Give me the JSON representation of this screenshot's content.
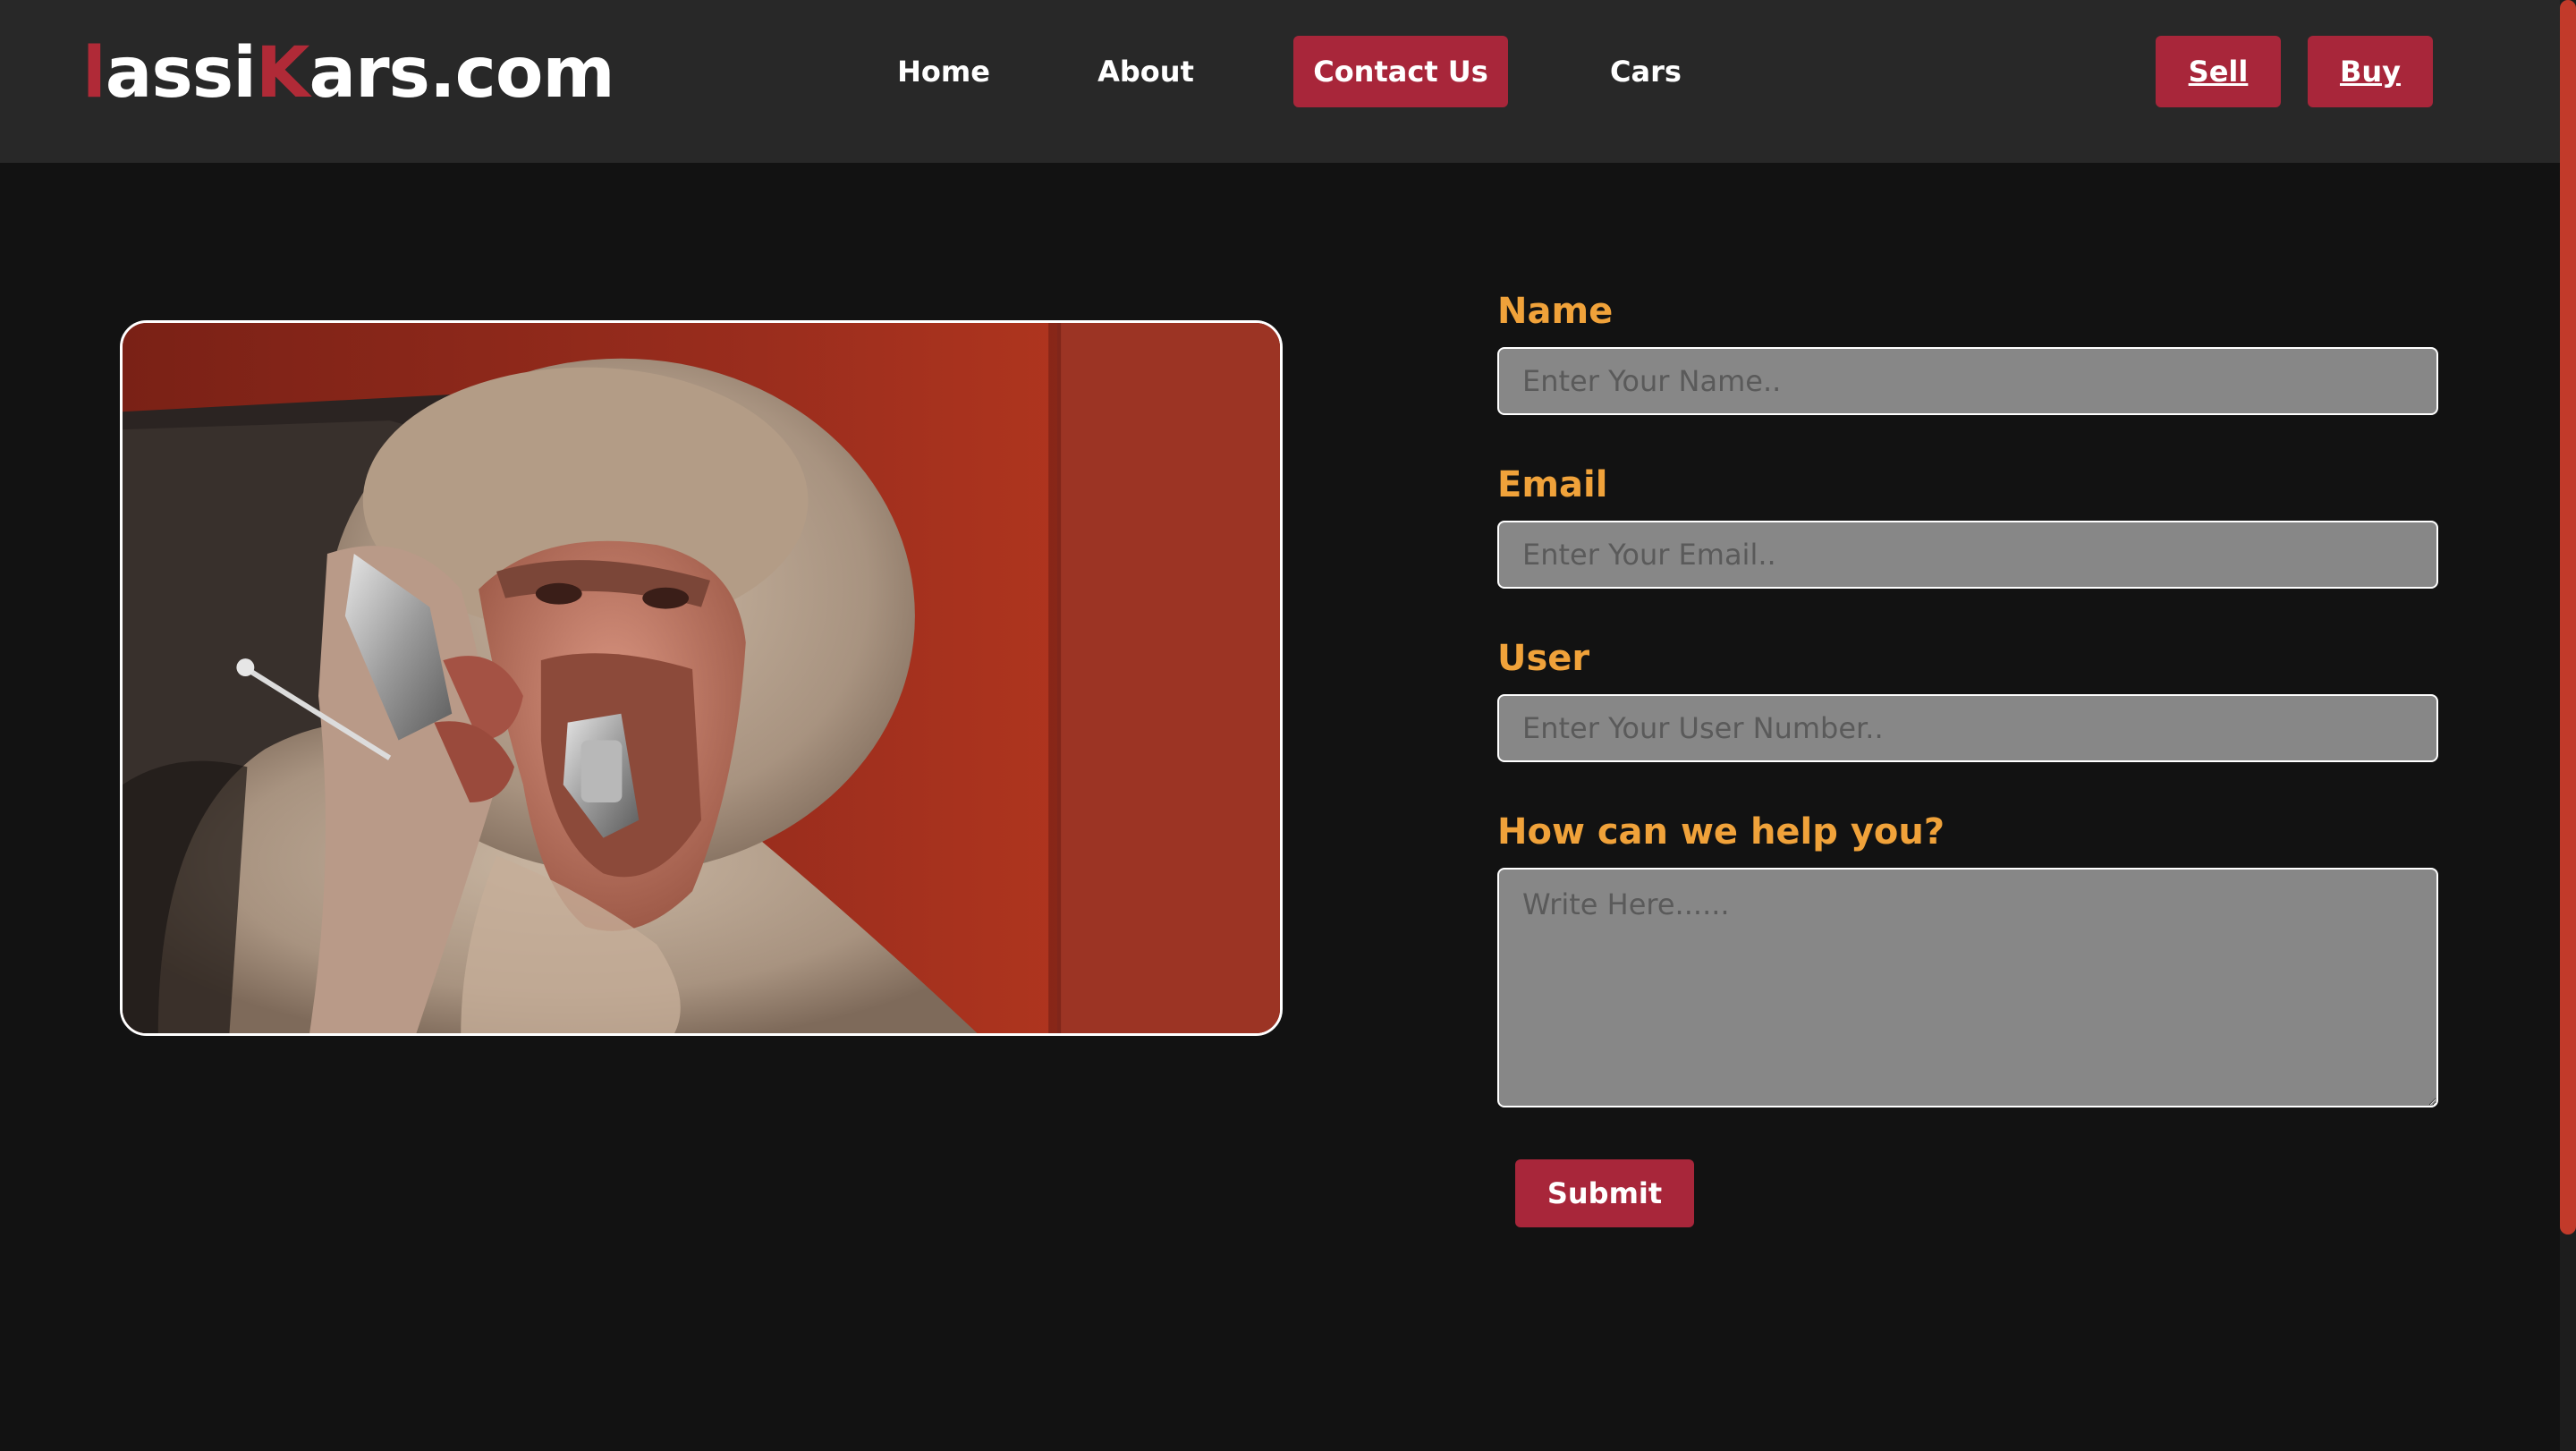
{
  "brand": {
    "logo_part1": "l",
    "logo_part2": "assi",
    "logo_part3": "K",
    "logo_part4": "ars.com",
    "accent_color": "#b02a37"
  },
  "nav": {
    "home": "Home",
    "about": "About",
    "contact": "Contact Us",
    "cars": "Cars",
    "sell": "Sell",
    "buy": "Buy",
    "active": "Contact Us"
  },
  "form": {
    "name_label": "Name",
    "name_placeholder": "Enter Your Name..",
    "email_label": "Email",
    "email_placeholder": "Enter Your Email..",
    "user_label": "User",
    "user_placeholder": "Enter Your User Number..",
    "help_label": "How can we help you?",
    "help_placeholder": "Write Here......",
    "submit_label": "Submit"
  },
  "colors": {
    "background": "#121212",
    "navbar": "#282828",
    "button": "#a8263a",
    "label": "#f0a23a",
    "input": "#878787"
  },
  "image": {
    "subject": "baboon talking on a flip phone"
  }
}
